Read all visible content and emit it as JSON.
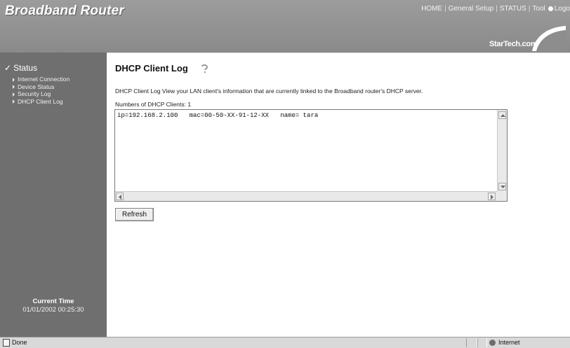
{
  "header": {
    "title": "Broadband Router",
    "nav": [
      "HOME",
      "General Setup",
      "STATUS",
      "Tool"
    ],
    "logout_label": "Logo",
    "brand": "StarTech.com"
  },
  "sidebar": {
    "section_title": "Status",
    "items": [
      {
        "label": "Internet Connection"
      },
      {
        "label": "Device Status"
      },
      {
        "label": "Security Log"
      },
      {
        "label": "DHCP Client Log"
      }
    ],
    "current_time_label": "Current Time",
    "current_time_value": "01/01/2002 00:25:30"
  },
  "main": {
    "title": "DHCP Client Log",
    "description": "DHCP Client Log View your LAN client's information that are currently linked to the Broadband router's DHCP server.",
    "count_label": "Numbers of DHCP Clients:",
    "count_value": "1",
    "log_entries": [
      "ip=192.168.2.100   mac=00-50-XX-91-12-XX   name= tara"
    ],
    "refresh_label": "Refresh"
  },
  "statusbar": {
    "left": "Done",
    "zone": "Internet"
  },
  "colors": {
    "header_bg": "#969696",
    "sidebar_bg": "#6f6f6f",
    "page_bg": "#ffffff"
  }
}
